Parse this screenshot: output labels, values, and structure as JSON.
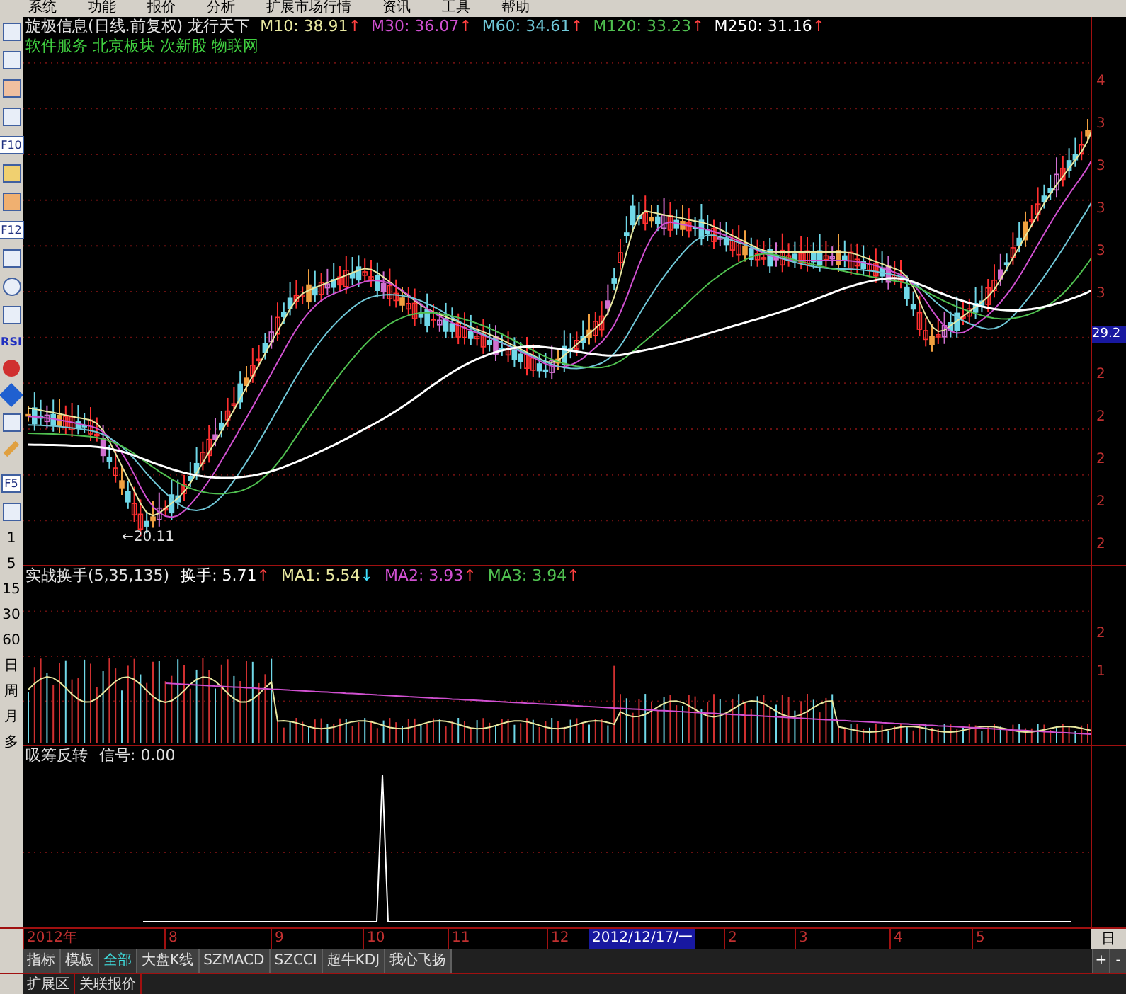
{
  "menu": [
    "系统",
    "功能",
    "报价",
    "分析",
    "扩展市场行情",
    "资讯",
    "工具",
    "帮助"
  ],
  "left_toolbar": {
    "labels": [
      "F10",
      "F12",
      "RSI",
      "F5"
    ],
    "periods": [
      "1",
      "5",
      "15",
      "30",
      "60",
      "日",
      "周",
      "月",
      "多"
    ]
  },
  "price_pane": {
    "title": "旋极信息(日线.前复权) 龙行天下",
    "averages": [
      {
        "label": "M10: 38.91",
        "color": "#e8e8a0",
        "arrow": {
          "text": "↑",
          "color": "#ff4040"
        }
      },
      {
        "label": "M30: 36.07",
        "color": "#d050d0",
        "arrow": {
          "text": "↑",
          "color": "#ff4040"
        }
      },
      {
        "label": "M60: 34.61",
        "color": "#70c8d8",
        "arrow": {
          "text": "↑",
          "color": "#ff4040"
        }
      },
      {
        "label": "M120: 33.23",
        "color": "#50c050",
        "arrow": {
          "text": "↑",
          "color": "#ff4040"
        }
      },
      {
        "label": "M250: 31.16",
        "color": "#ffffff",
        "arrow": {
          "text": "↑",
          "color": "#ff4040"
        }
      }
    ],
    "concepts": "软件服务 北京板块 次新股 物联网",
    "low_marker": "←20.11",
    "axis": [
      {
        "label": "4",
        "kind": "tick"
      },
      {
        "label": "3",
        "kind": "tick"
      },
      {
        "label": "3",
        "kind": "tick"
      },
      {
        "label": "3",
        "kind": "tick"
      },
      {
        "label": "3",
        "kind": "tick"
      },
      {
        "label": "3",
        "kind": "tick"
      },
      {
        "label": "29.2",
        "kind": "cursor"
      },
      {
        "label": "2",
        "kind": "tick"
      },
      {
        "label": "2",
        "kind": "tick"
      },
      {
        "label": "2",
        "kind": "tick"
      },
      {
        "label": "2",
        "kind": "tick"
      },
      {
        "label": "2",
        "kind": "tick"
      }
    ]
  },
  "volume_pane": {
    "title": "实战换手(5,35,135)",
    "values": [
      {
        "label": "换手: 5.71",
        "color": "#ffffff",
        "arrow": {
          "text": "↑",
          "color": "#ff4040"
        }
      },
      {
        "label": "MA1: 5.54",
        "color": "#e8e8a0",
        "arrow": {
          "text": "↓",
          "color": "#40e0ff"
        }
      },
      {
        "label": "MA2: 3.93",
        "color": "#d050d0",
        "arrow": {
          "text": "↑",
          "color": "#ff4040"
        }
      },
      {
        "label": "MA3: 3.94",
        "color": "#50c050",
        "arrow": {
          "text": "↑",
          "color": "#ff4040"
        }
      }
    ],
    "axis": [
      "2",
      "1"
    ]
  },
  "signal_pane": {
    "title": "吸筹反转",
    "value": "信号: 0.00"
  },
  "date_axis": [
    {
      "label": "2012年",
      "kind": "tick"
    },
    {
      "label": "8",
      "kind": "tick"
    },
    {
      "label": "9",
      "kind": "tick"
    },
    {
      "label": "10",
      "kind": "tick"
    },
    {
      "label": "11",
      "kind": "tick"
    },
    {
      "label": "12",
      "kind": "tick"
    },
    {
      "label": "2012/12/17/一",
      "kind": "cursor"
    },
    {
      "label": "2",
      "kind": "tick"
    },
    {
      "label": "3",
      "kind": "tick"
    },
    {
      "label": "4",
      "kind": "tick"
    },
    {
      "label": "5",
      "kind": "tick"
    }
  ],
  "period_button": "日",
  "tabs": [
    {
      "label": "指标",
      "selected": false
    },
    {
      "label": "模板",
      "selected": false
    },
    {
      "label": "全部",
      "selected": true
    },
    {
      "label": "大盘K线",
      "selected": false
    },
    {
      "label": "SZMACD",
      "selected": false
    },
    {
      "label": "SZCCI",
      "selected": false
    },
    {
      "label": "超牛KDJ",
      "selected": false
    },
    {
      "label": "我心飞扬",
      "selected": false
    }
  ],
  "tab_controls": [
    "+",
    "-"
  ],
  "bottom_tabs": [
    "扩展区",
    "关联报价"
  ]
}
